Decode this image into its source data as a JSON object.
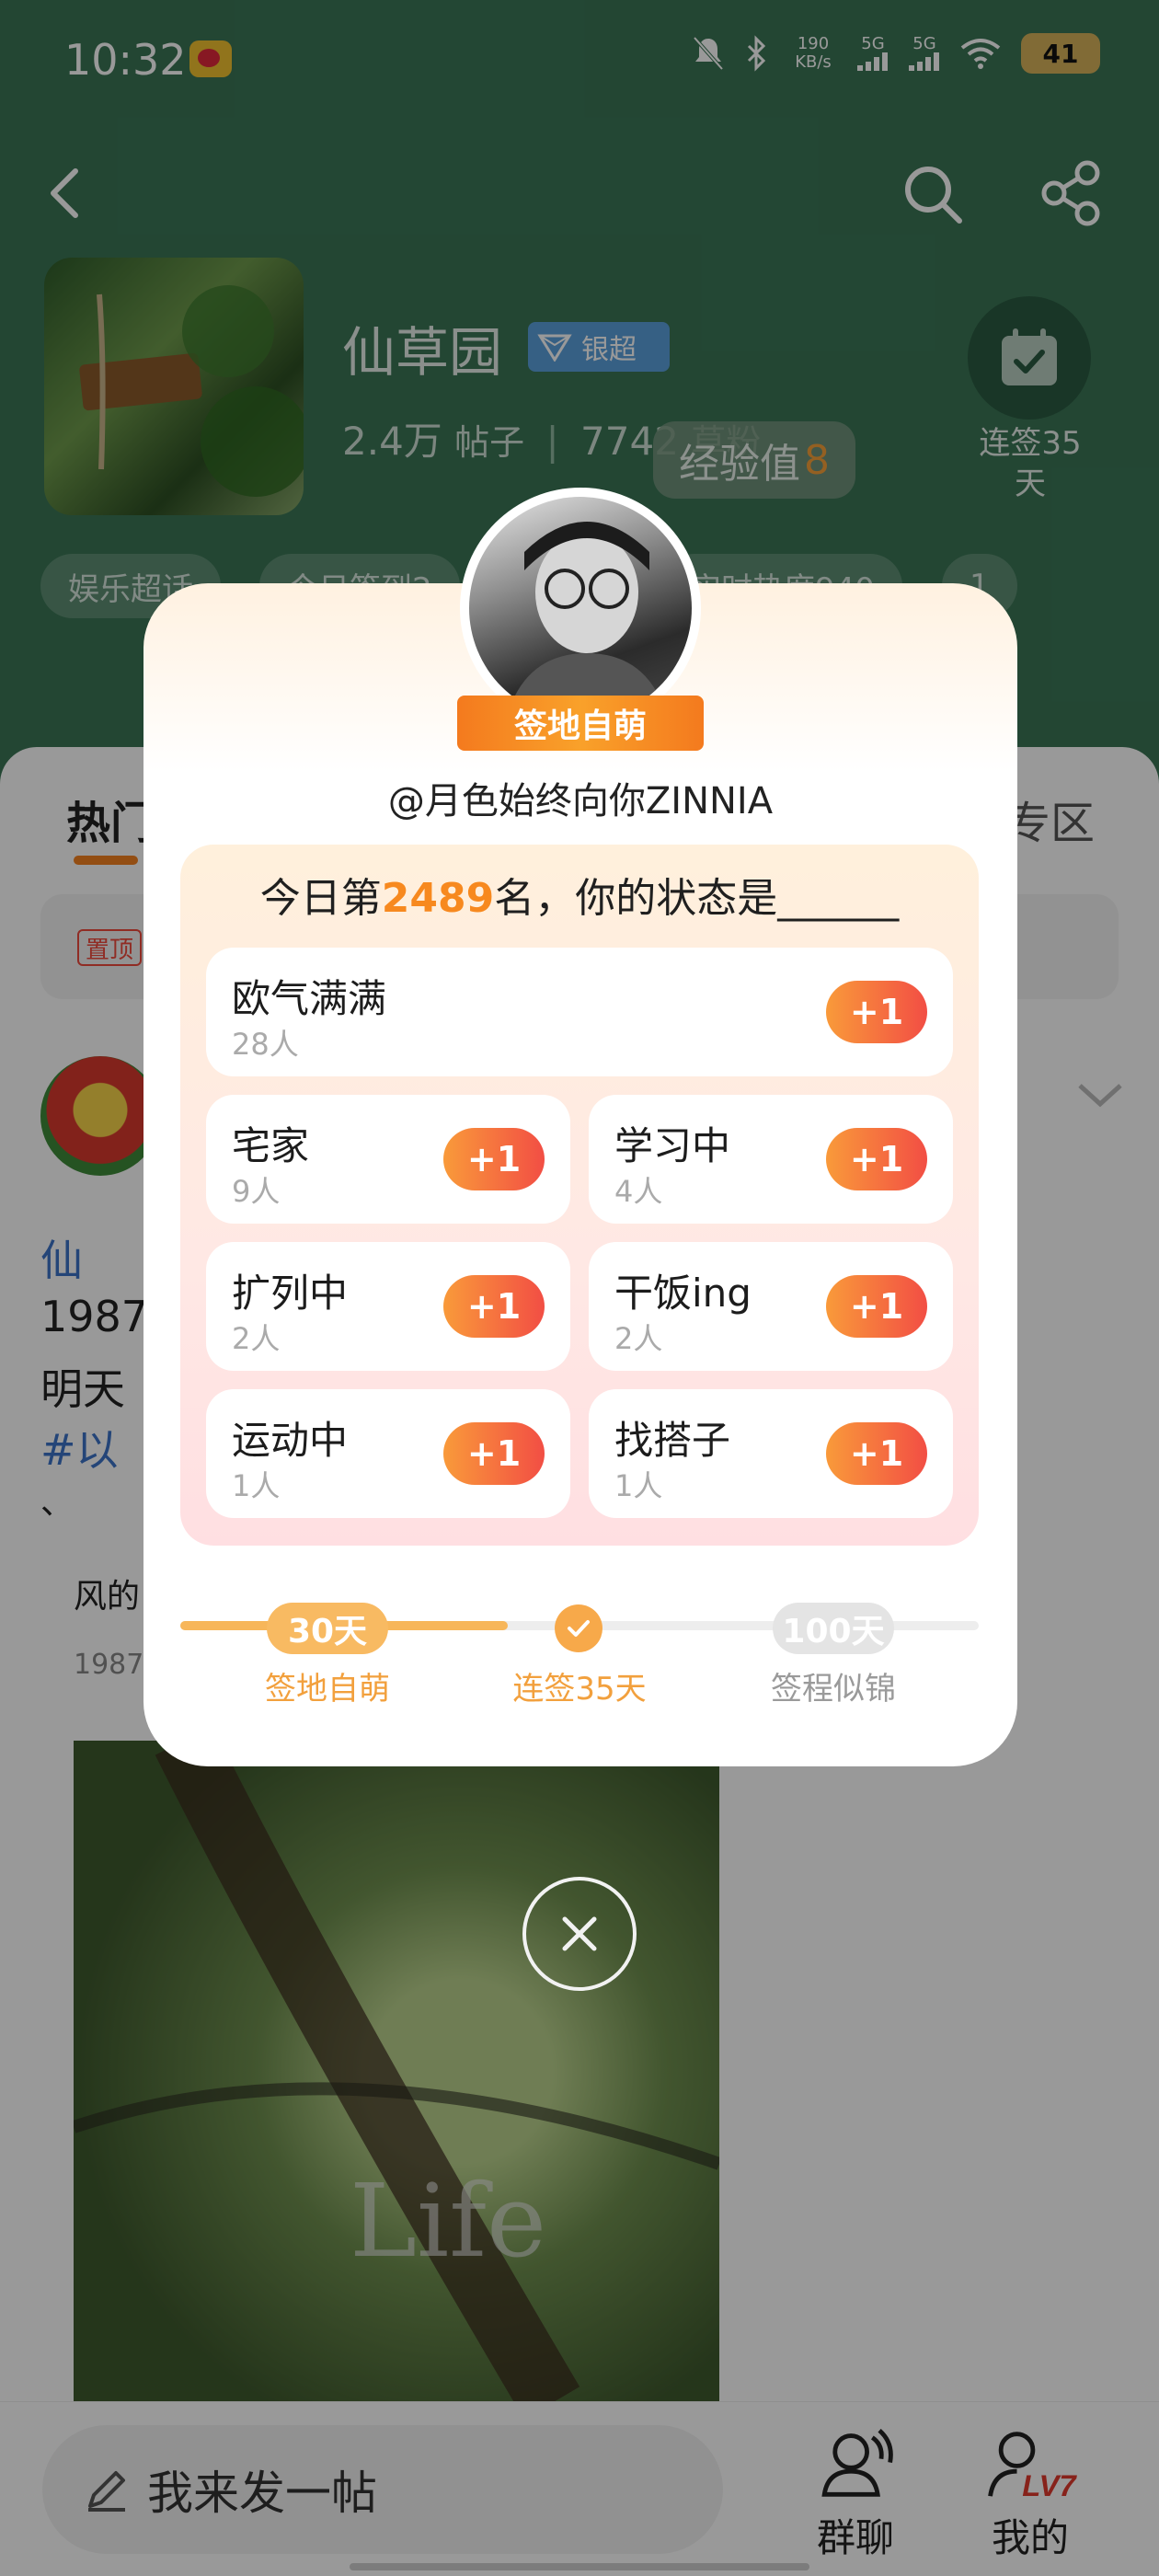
{
  "status_bar": {
    "time": "10:32",
    "net_speed_value": "190",
    "net_speed_unit": "KB/s",
    "signal_1": "5G",
    "signal_2": "5G",
    "battery": "41"
  },
  "header": {
    "group_name": "仙草园",
    "badge_label": "银超",
    "posts_count": "2.4万",
    "posts_unit": "帖子",
    "fans_count": "7742",
    "fans_unit": "草粉",
    "exp_label": "经验值",
    "exp_value": "8",
    "checkin_days_label": "连签35天"
  },
  "tags": [
    "娱乐超话",
    "今日签到2",
    "实时热度940",
    "1"
  ],
  "tabs": {
    "hot": "热门",
    "zone": "专区"
  },
  "feed": {
    "pin_label": "置顶",
    "line1": "仙",
    "line2": "1987",
    "line3": "明天",
    "line4": "#以",
    "line5": "、",
    "line6": "风的",
    "line7": "1987",
    "image_text": "Life"
  },
  "bottom": {
    "compose_placeholder": "我来发一帖",
    "nav_group": "群聊",
    "nav_me": "我的",
    "level_badge": "LV7"
  },
  "modal": {
    "ribbon": "签地自萌",
    "username": "@月色始终向你ZINNIA",
    "title_prefix": "今日第",
    "rank": "2489",
    "title_suffix": "名，你的状态是______",
    "plus_label": "+1",
    "options": [
      {
        "name": "欧气满满",
        "count": "28人"
      },
      {
        "name": "宅家",
        "count": "9人"
      },
      {
        "name": "学习中",
        "count": "4人"
      },
      {
        "name": "扩列中",
        "count": "2人"
      },
      {
        "name": "干饭ing",
        "count": "2人"
      },
      {
        "name": "运动中",
        "count": "1人"
      },
      {
        "name": "找搭子",
        "count": "1人"
      }
    ],
    "progress": {
      "current_days": 35,
      "milestones": [
        {
          "value": "30天",
          "label": "签地自萌"
        },
        {
          "value": "",
          "label": "连签35天"
        },
        {
          "value": "100天",
          "label": "签程似锦"
        }
      ]
    }
  },
  "colors": {
    "header_bg": "#3b7656",
    "accent_orange": "#f7891f",
    "plus_gradient_start": "#f99a3a",
    "plus_gradient_end": "#f24e44"
  }
}
